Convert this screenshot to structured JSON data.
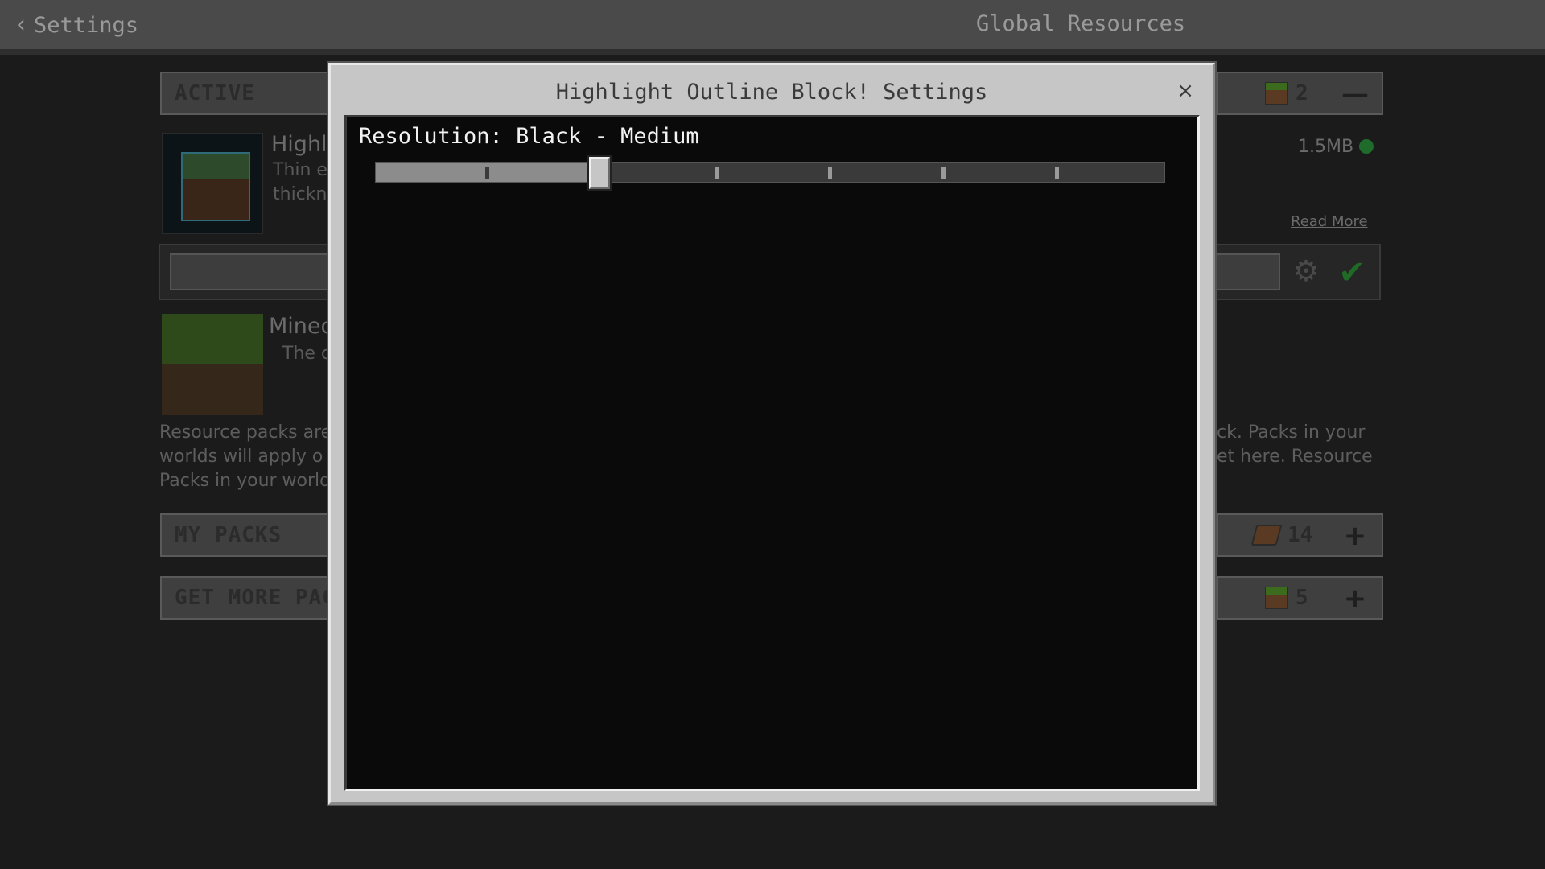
{
  "topbar": {
    "back_label": "Settings",
    "title": "Global Resources"
  },
  "background": {
    "active_header": "ACTIVE",
    "active_count": "2",
    "pack1_title": "Highl",
    "pack1_desc_line1": "Thin e",
    "pack1_desc_line2": "thickn",
    "pack1_size": "1.5MB",
    "read_more": "Read More",
    "pack2_title": "Minec",
    "pack2_desc": "The c",
    "info_left_1": "Resource packs are",
    "info_left_2": "worlds will apply o",
    "info_left_3": "Packs in your world",
    "info_right_1": "ck. Packs in your",
    "info_right_2": "et here. Resource",
    "my_packs_header": "MY PACKS",
    "my_packs_count": "14",
    "get_more_header": "GET MORE PAC",
    "get_more_count": "5"
  },
  "modal": {
    "title": "Highlight Outline Block! Settings",
    "close_glyph": "×",
    "setting_label": "Resolution: Black - Medium",
    "slider": {
      "steps": 7,
      "selected_step": 2
    }
  },
  "colors": {
    "accent_green": "#1f6b26",
    "modal_bg": "#c6c6c6"
  }
}
